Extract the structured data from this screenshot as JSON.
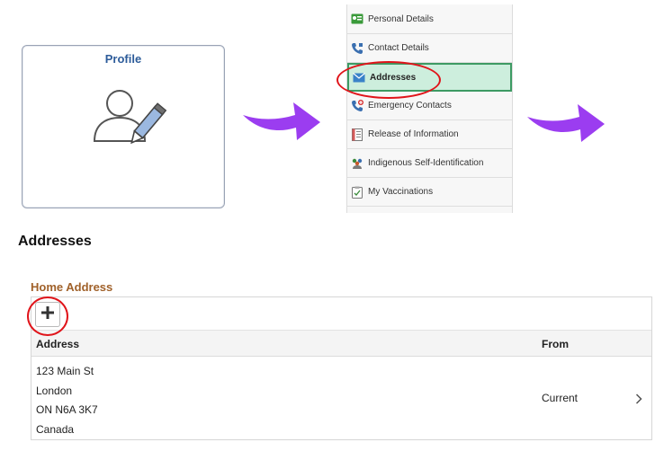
{
  "profile": {
    "title": "Profile",
    "icon": "user-edit-icon"
  },
  "menu": {
    "items": [
      {
        "label": "Personal Details",
        "icon": "id-card-icon",
        "active": false
      },
      {
        "label": "Contact Details",
        "icon": "phone-icon",
        "active": false
      },
      {
        "label": "Addresses",
        "icon": "envelope-icon",
        "active": true
      },
      {
        "label": "Emergency Contacts",
        "icon": "emergency-phone-icon",
        "active": false
      },
      {
        "label": "Release of Information",
        "icon": "document-icon",
        "active": false
      },
      {
        "label": "Indigenous Self-Identification",
        "icon": "people-icon",
        "active": false
      },
      {
        "label": "My Vaccinations",
        "icon": "clipboard-icon",
        "active": false
      }
    ]
  },
  "addresses": {
    "heading": "Addresses",
    "section_title": "Home Address",
    "add_label": "+",
    "columns": {
      "address": "Address",
      "from": "From"
    },
    "rows": [
      {
        "line1": "123 Main St",
        "line2": "London",
        "line3": "ON N6A 3K7",
        "line4": "Canada",
        "from": "Current"
      }
    ]
  },
  "colors": {
    "accent_blue": "#2d5c9a",
    "arrow_purple": "#9b3df0",
    "highlight_red": "#e0141a",
    "active_green": "#cdeedd",
    "section_brown": "#a0612a"
  }
}
